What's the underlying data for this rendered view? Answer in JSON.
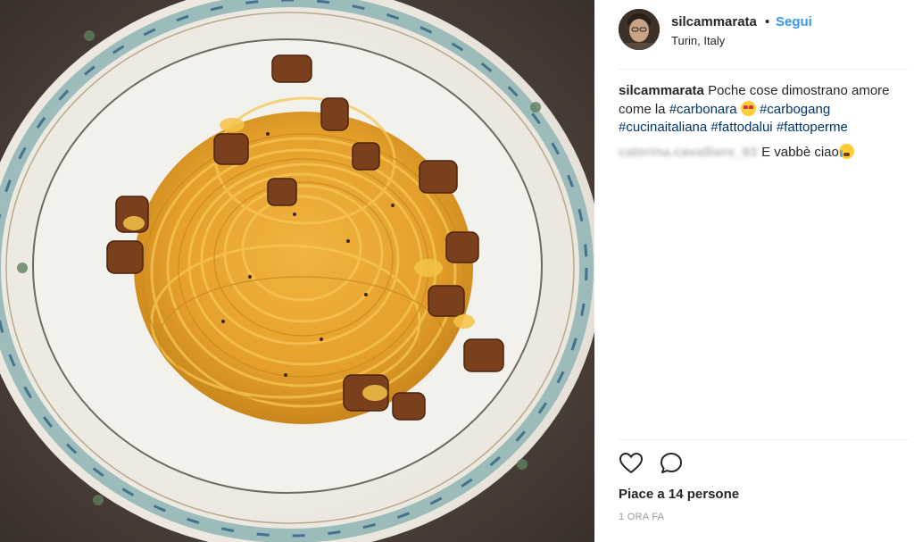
{
  "post": {
    "header": {
      "username": "silcammarata",
      "separator": "•",
      "follow_label": "Segui",
      "location": "Turin, Italy"
    },
    "caption": {
      "author": "silcammarata",
      "text_1": "Poche cose dimostrano amore come la",
      "hashtag_1": "#carbonara",
      "hashtag_2": "#carbogang",
      "hashtag_3": "#cucinaitaliana",
      "hashtag_4": "#fattodalui",
      "hashtag_5": "#fattoperme",
      "emoji_1": "heart-eyes-emoji"
    },
    "comment": {
      "author_blurred": "caterina.cavalliere_93",
      "text": "E vabbè ciao",
      "emoji": "loudly-crying-emoji"
    },
    "actions": {
      "like_icon": "heart-outline-icon",
      "comment_icon": "speech-bubble-icon"
    },
    "likes_text": "Piace a 14 persone",
    "timestamp": "1 ORA FA"
  },
  "colors": {
    "link_blue": "#3897f0",
    "hashtag_blue": "#003569",
    "text": "#262626",
    "muted": "#999999",
    "divider": "#efefef"
  }
}
